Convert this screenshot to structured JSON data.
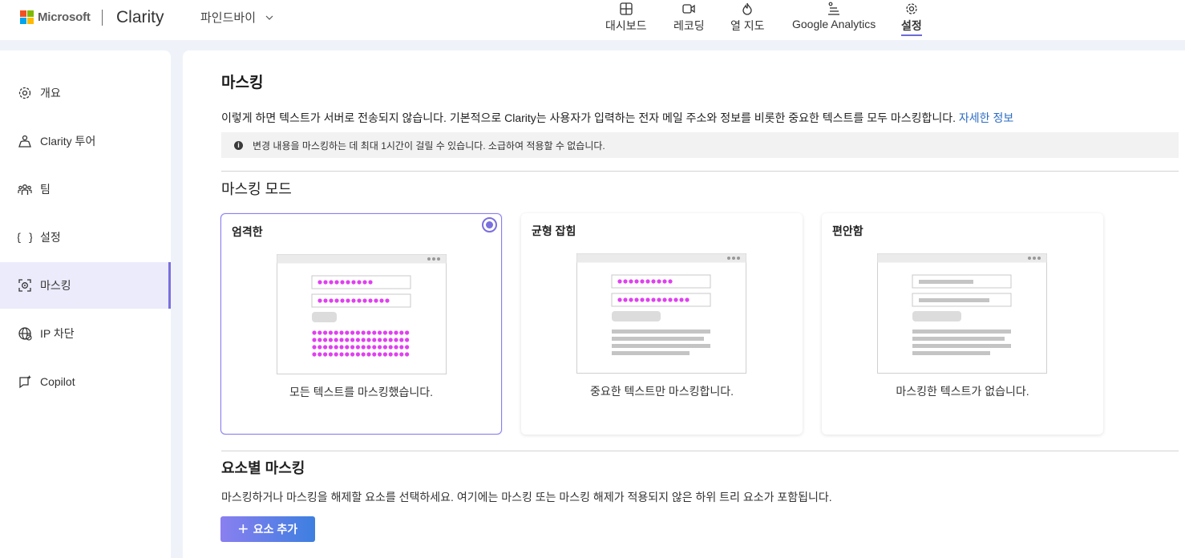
{
  "header": {
    "brand": "Microsoft",
    "app_name": "Clarity",
    "project": "파인드바이",
    "tabs": [
      {
        "label": "대시보드",
        "icon": "dashboard-icon"
      },
      {
        "label": "레코딩",
        "icon": "video-icon"
      },
      {
        "label": "열 지도",
        "icon": "flame-icon"
      },
      {
        "label": "Google Analytics",
        "icon": "analytics-icon"
      },
      {
        "label": "설정",
        "icon": "gear-icon",
        "active": true
      }
    ]
  },
  "sidebar": {
    "items": [
      {
        "label": "개요",
        "icon": "gear-icon"
      },
      {
        "label": "Clarity 투어",
        "icon": "person-icon"
      },
      {
        "label": "팀",
        "icon": "team-icon"
      },
      {
        "label": "설정",
        "icon": "braces-icon"
      },
      {
        "label": "마스킹",
        "icon": "masking-icon",
        "active": true
      },
      {
        "label": "IP 차단",
        "icon": "globe-icon"
      },
      {
        "label": "Copilot",
        "icon": "copilot-icon"
      }
    ]
  },
  "main": {
    "title": "마스킹",
    "description": "이렇게 하면 텍스트가 서버로 전송되지 않습니다. 기본적으로 Clarity는 사용자가 입력하는 전자 메일 주소와 정보를 비롯한 중요한 텍스트를 모두 마스킹합니다.",
    "learn_more": "자세한 정보",
    "note": "변경 내용을 마스킹하는 데 최대 1시간이 걸릴 수 있습니다. 소급하여 적용할 수 없습니다.",
    "mode_title": "마스킹 모드",
    "modes": [
      {
        "title": "엄격한",
        "caption": "모든 텍스트를 마스킹했습니다.",
        "selected": true
      },
      {
        "title": "균형 잡힘",
        "caption": "중요한 텍스트만 마스킹합니다.",
        "selected": false
      },
      {
        "title": "편안함",
        "caption": "마스킹한 텍스트가 없습니다.",
        "selected": false
      }
    ],
    "element_title": "요소별 마스킹",
    "element_desc": "마스킹하거나 마스킹을 해제할 요소를 선택하세요. 여기에는 마스킹 또는 마스킹 해제가 적용되지 않은 하위 트리 요소가 포함됩니다.",
    "add_button": "요소 추가"
  },
  "colors": {
    "accent": "#7a6fde",
    "mask_dots": "#e040f0",
    "link": "#2b6cc4",
    "ms_red": "#f25022",
    "ms_green": "#7fba00",
    "ms_blue": "#00a4ef",
    "ms_yellow": "#ffb900"
  }
}
